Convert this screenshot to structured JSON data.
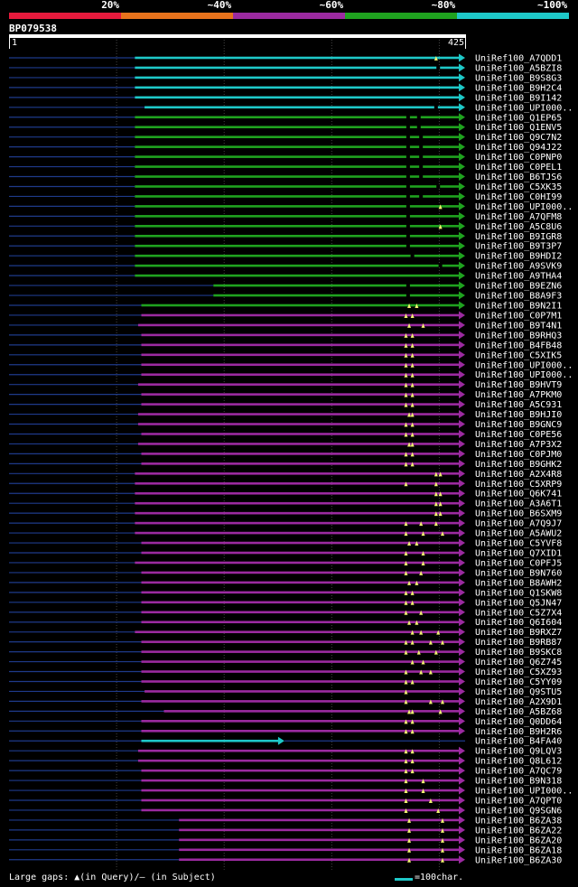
{
  "legend": {
    "bins": [
      {
        "label": "20%",
        "color": "#e51a3c"
      },
      {
        "label": "~40%",
        "color": "#e8731c"
      },
      {
        "label": "~60%",
        "color": "#9b2aa0"
      },
      {
        "label": "~80%",
        "color": "#1fa21f"
      },
      {
        "label": "~100%",
        "color": "#1ec8c8"
      }
    ]
  },
  "chart_data": {
    "type": "alignment",
    "query": {
      "name": "BP079538",
      "length": 425,
      "start_label": "1",
      "end_label": "425"
    },
    "colors": {
      "cyan": "#1ec8c8",
      "green": "#1fa21f",
      "purple": "#9b2aa0",
      "subject": "#1e3a8a",
      "marker": "#f0f070",
      "grid": "#444444"
    },
    "hits": [
      {
        "name": "UniRef100_A7QDD1",
        "q_start": 118,
        "q_end": 425,
        "color": "cyan",
        "ins": [
          398
        ],
        "subj_marks": []
      },
      {
        "name": "UniRef100_A5BZI8",
        "q_start": 118,
        "q_end": 425,
        "color": "cyan",
        "ins": [],
        "subj_marks": [
          400
        ]
      },
      {
        "name": "UniRef100_B9S8G3",
        "q_start": 118,
        "q_end": 425,
        "color": "cyan",
        "ins": [],
        "subj_marks": []
      },
      {
        "name": "UniRef100_B9H2C4",
        "q_start": 118,
        "q_end": 425,
        "color": "cyan",
        "ins": [],
        "subj_marks": []
      },
      {
        "name": "UniRef100_B9I142",
        "q_start": 118,
        "q_end": 425,
        "color": "cyan",
        "ins": [],
        "subj_marks": []
      },
      {
        "name": "UniRef100_UPI000..",
        "q_start": 127,
        "q_end": 425,
        "color": "cyan",
        "ins": [],
        "subj_marks": [
          398
        ]
      },
      {
        "name": "UniRef100_Q1EP65",
        "q_start": 118,
        "q_end": 425,
        "color": "green",
        "ins": [],
        "subj_marks": [
          372,
          382
        ]
      },
      {
        "name": "UniRef100_Q1ENV5",
        "q_start": 118,
        "q_end": 425,
        "color": "green",
        "ins": [],
        "subj_marks": [
          372,
          382
        ]
      },
      {
        "name": "UniRef100_Q9C7N2",
        "q_start": 118,
        "q_end": 425,
        "color": "green",
        "ins": [],
        "subj_marks": [
          372,
          384
        ]
      },
      {
        "name": "UniRef100_Q94J22",
        "q_start": 118,
        "q_end": 425,
        "color": "green",
        "ins": [],
        "subj_marks": [
          372,
          384
        ]
      },
      {
        "name": "UniRef100_C0PNP0",
        "q_start": 118,
        "q_end": 425,
        "color": "green",
        "ins": [],
        "subj_marks": [
          372,
          384
        ]
      },
      {
        "name": "UniRef100_C0PEL1",
        "q_start": 118,
        "q_end": 425,
        "color": "green",
        "ins": [],
        "subj_marks": [
          372,
          384
        ]
      },
      {
        "name": "UniRef100_B6TJS6",
        "q_start": 118,
        "q_end": 425,
        "color": "green",
        "ins": [],
        "subj_marks": [
          372,
          384
        ]
      },
      {
        "name": "UniRef100_C5XK35",
        "q_start": 118,
        "q_end": 425,
        "color": "green",
        "ins": [],
        "subj_marks": [
          372,
          400
        ]
      },
      {
        "name": "UniRef100_C0HI99",
        "q_start": 118,
        "q_end": 425,
        "color": "green",
        "ins": [],
        "subj_marks": [
          372,
          384
        ]
      },
      {
        "name": "UniRef100_UPI000..",
        "q_start": 118,
        "q_end": 425,
        "color": "green",
        "ins": [
          402
        ],
        "subj_marks": [
          372
        ]
      },
      {
        "name": "UniRef100_A7QFM8",
        "q_start": 118,
        "q_end": 425,
        "color": "green",
        "ins": [],
        "subj_marks": [
          372
        ]
      },
      {
        "name": "UniRef100_A5C8U6",
        "q_start": 118,
        "q_end": 425,
        "color": "green",
        "ins": [
          402
        ],
        "subj_marks": [
          372
        ]
      },
      {
        "name": "UniRef100_B9IGR8",
        "q_start": 118,
        "q_end": 425,
        "color": "green",
        "ins": [],
        "subj_marks": [
          372
        ]
      },
      {
        "name": "UniRef100_B9T3P7",
        "q_start": 118,
        "q_end": 425,
        "color": "green",
        "ins": [],
        "subj_marks": [
          372
        ]
      },
      {
        "name": "UniRef100_B9HDI2",
        "q_start": 118,
        "q_end": 425,
        "color": "green",
        "ins": [],
        "subj_marks": [
          376
        ]
      },
      {
        "name": "UniRef100_A9SVK9",
        "q_start": 118,
        "q_end": 425,
        "color": "green",
        "ins": [],
        "subj_marks": [
          402
        ]
      },
      {
        "name": "UniRef100_A9THA4",
        "q_start": 118,
        "q_end": 425,
        "color": "green",
        "ins": [],
        "subj_marks": []
      },
      {
        "name": "UniRef100_B9EZN6",
        "q_start": 191,
        "q_end": 425,
        "color": "green",
        "ins": [],
        "subj_marks": [
          372
        ]
      },
      {
        "name": "UniRef100_B8A9F3",
        "q_start": 191,
        "q_end": 425,
        "color": "green",
        "ins": [],
        "subj_marks": [
          372
        ]
      },
      {
        "name": "UniRef100_B9N2I1",
        "q_start": 124,
        "q_end": 425,
        "color": "green",
        "ins": [
          373,
          380
        ],
        "subj_marks": []
      },
      {
        "name": "UniRef100_C0P7M1",
        "q_start": 124,
        "q_end": 425,
        "color": "purple",
        "ins": [
          370,
          376
        ],
        "subj_marks": []
      },
      {
        "name": "UniRef100_B9T4N1",
        "q_start": 121,
        "q_end": 425,
        "color": "purple",
        "ins": [
          373,
          386
        ],
        "subj_marks": []
      },
      {
        "name": "UniRef100_B9RHQ3",
        "q_start": 124,
        "q_end": 425,
        "color": "purple",
        "ins": [
          370,
          376
        ],
        "subj_marks": []
      },
      {
        "name": "UniRef100_B4FB48",
        "q_start": 124,
        "q_end": 425,
        "color": "purple",
        "ins": [
          370,
          376
        ],
        "subj_marks": []
      },
      {
        "name": "UniRef100_C5XIK5",
        "q_start": 124,
        "q_end": 425,
        "color": "purple",
        "ins": [
          370,
          376
        ],
        "subj_marks": []
      },
      {
        "name": "UniRef100_UPI000..",
        "q_start": 124,
        "q_end": 425,
        "color": "purple",
        "ins": [
          370,
          376
        ],
        "subj_marks": []
      },
      {
        "name": "UniRef100_UPI000..",
        "q_start": 124,
        "q_end": 425,
        "color": "purple",
        "ins": [
          370,
          376
        ],
        "subj_marks": []
      },
      {
        "name": "UniRef100_B9HVT9",
        "q_start": 121,
        "q_end": 425,
        "color": "purple",
        "ins": [
          370,
          376
        ],
        "subj_marks": []
      },
      {
        "name": "UniRef100_A7PKM0",
        "q_start": 124,
        "q_end": 425,
        "color": "purple",
        "ins": [
          370,
          376
        ],
        "subj_marks": []
      },
      {
        "name": "UniRef100_A5C931",
        "q_start": 124,
        "q_end": 425,
        "color": "purple",
        "ins": [
          370,
          376
        ],
        "subj_marks": []
      },
      {
        "name": "UniRef100_B9HJI0",
        "q_start": 121,
        "q_end": 425,
        "color": "purple",
        "ins": [
          373,
          376
        ],
        "subj_marks": []
      },
      {
        "name": "UniRef100_B9GNC9",
        "q_start": 121,
        "q_end": 425,
        "color": "purple",
        "ins": [
          370,
          376
        ],
        "subj_marks": []
      },
      {
        "name": "UniRef100_C0PE56",
        "q_start": 124,
        "q_end": 425,
        "color": "purple",
        "ins": [
          370,
          376
        ],
        "subj_marks": []
      },
      {
        "name": "UniRef100_A7P3X2",
        "q_start": 121,
        "q_end": 425,
        "color": "purple",
        "ins": [
          373,
          376
        ],
        "subj_marks": []
      },
      {
        "name": "UniRef100_C0PJM0",
        "q_start": 124,
        "q_end": 425,
        "color": "purple",
        "ins": [
          370,
          376
        ],
        "subj_marks": []
      },
      {
        "name": "UniRef100_B9GHK2",
        "q_start": 124,
        "q_end": 425,
        "color": "purple",
        "ins": [
          370,
          376
        ],
        "subj_marks": []
      },
      {
        "name": "UniRef100_A2X4R8",
        "q_start": 118,
        "q_end": 425,
        "color": "purple",
        "ins": [
          398,
          402
        ],
        "subj_marks": []
      },
      {
        "name": "UniRef100_C5XRP9",
        "q_start": 118,
        "q_end": 425,
        "color": "purple",
        "ins": [
          370,
          398
        ],
        "subj_marks": []
      },
      {
        "name": "UniRef100_Q6K741",
        "q_start": 118,
        "q_end": 425,
        "color": "purple",
        "ins": [
          398,
          402
        ],
        "subj_marks": []
      },
      {
        "name": "UniRef100_A3A6T1",
        "q_start": 118,
        "q_end": 425,
        "color": "purple",
        "ins": [
          398,
          402
        ],
        "subj_marks": []
      },
      {
        "name": "UniRef100_B6SXM9",
        "q_start": 118,
        "q_end": 425,
        "color": "purple",
        "ins": [
          398,
          402
        ],
        "subj_marks": []
      },
      {
        "name": "UniRef100_A7Q9J7",
        "q_start": 118,
        "q_end": 425,
        "color": "purple",
        "ins": [
          370,
          384,
          398
        ],
        "subj_marks": []
      },
      {
        "name": "UniRef100_A5AWU2",
        "q_start": 118,
        "q_end": 425,
        "color": "purple",
        "ins": [
          370,
          386,
          404
        ],
        "subj_marks": []
      },
      {
        "name": "UniRef100_C5YVF8",
        "q_start": 124,
        "q_end": 425,
        "color": "purple",
        "ins": [
          373,
          380
        ],
        "subj_marks": []
      },
      {
        "name": "UniRef100_Q7XID1",
        "q_start": 124,
        "q_end": 425,
        "color": "purple",
        "ins": [
          370,
          386
        ],
        "subj_marks": []
      },
      {
        "name": "UniRef100_C0PFJ5",
        "q_start": 118,
        "q_end": 425,
        "color": "purple",
        "ins": [
          370,
          386
        ],
        "subj_marks": []
      },
      {
        "name": "UniRef100_B9N760",
        "q_start": 124,
        "q_end": 425,
        "color": "purple",
        "ins": [
          370,
          384
        ],
        "subj_marks": []
      },
      {
        "name": "UniRef100_B8AWH2",
        "q_start": 124,
        "q_end": 425,
        "color": "purple",
        "ins": [
          373,
          380
        ],
        "subj_marks": []
      },
      {
        "name": "UniRef100_Q1SKW8",
        "q_start": 124,
        "q_end": 425,
        "color": "purple",
        "ins": [
          370,
          376
        ],
        "subj_marks": []
      },
      {
        "name": "UniRef100_Q5JN47",
        "q_start": 124,
        "q_end": 425,
        "color": "purple",
        "ins": [
          370,
          376
        ],
        "subj_marks": []
      },
      {
        "name": "UniRef100_C5Z7X4",
        "q_start": 124,
        "q_end": 425,
        "color": "purple",
        "ins": [
          370,
          384
        ],
        "subj_marks": []
      },
      {
        "name": "UniRef100_Q6I604",
        "q_start": 124,
        "q_end": 425,
        "color": "purple",
        "ins": [
          373,
          380
        ],
        "subj_marks": []
      },
      {
        "name": "UniRef100_B9RXZ7",
        "q_start": 118,
        "q_end": 425,
        "color": "purple",
        "ins": [
          376,
          384,
          400
        ],
        "subj_marks": []
      },
      {
        "name": "UniRef100_B9RB87",
        "q_start": 124,
        "q_end": 425,
        "color": "purple",
        "ins": [
          370,
          376,
          393,
          404
        ],
        "subj_marks": []
      },
      {
        "name": "UniRef100_B9SKC8",
        "q_start": 124,
        "q_end": 425,
        "color": "purple",
        "ins": [
          370,
          382,
          398
        ],
        "subj_marks": []
      },
      {
        "name": "UniRef100_Q6Z745",
        "q_start": 124,
        "q_end": 425,
        "color": "purple",
        "ins": [
          376,
          386
        ],
        "subj_marks": []
      },
      {
        "name": "UniRef100_C5XZ93",
        "q_start": 124,
        "q_end": 425,
        "color": "purple",
        "ins": [
          370,
          384,
          393
        ],
        "subj_marks": []
      },
      {
        "name": "UniRef100_C5YY09",
        "q_start": 124,
        "q_end": 425,
        "color": "purple",
        "ins": [
          370,
          376
        ],
        "subj_marks": []
      },
      {
        "name": "UniRef100_Q9STU5",
        "q_start": 127,
        "q_end": 425,
        "color": "purple",
        "ins": [
          370
        ],
        "subj_marks": []
      },
      {
        "name": "UniRef100_A2X9D1",
        "q_start": 124,
        "q_end": 425,
        "color": "purple",
        "ins": [
          370,
          393,
          404
        ],
        "subj_marks": []
      },
      {
        "name": "UniRef100_A5BZ68",
        "q_start": 145,
        "q_end": 425,
        "color": "purple",
        "ins": [
          373,
          376,
          402
        ],
        "subj_marks": []
      },
      {
        "name": "UniRef100_Q0DD64",
        "q_start": 124,
        "q_end": 425,
        "color": "purple",
        "ins": [
          370,
          376
        ],
        "subj_marks": []
      },
      {
        "name": "UniRef100_B9H2R6",
        "q_start": 124,
        "q_end": 425,
        "color": "purple",
        "ins": [
          370,
          376
        ],
        "subj_marks": []
      },
      {
        "name": "UniRef100_B4FA40",
        "q_start": 124,
        "q_end": 257,
        "color": "cyan",
        "ins": [],
        "subj_marks": []
      },
      {
        "name": "UniRef100_Q9LQV3",
        "q_start": 121,
        "q_end": 425,
        "color": "purple",
        "ins": [
          370,
          376
        ],
        "subj_marks": []
      },
      {
        "name": "UniRef100_Q8L612",
        "q_start": 121,
        "q_end": 425,
        "color": "purple",
        "ins": [
          370,
          376
        ],
        "subj_marks": []
      },
      {
        "name": "UniRef100_A7QC79",
        "q_start": 124,
        "q_end": 425,
        "color": "purple",
        "ins": [
          370,
          376
        ],
        "subj_marks": []
      },
      {
        "name": "UniRef100_B9N318",
        "q_start": 124,
        "q_end": 425,
        "color": "purple",
        "ins": [
          370,
          386
        ],
        "subj_marks": []
      },
      {
        "name": "UniRef100_UPI000..",
        "q_start": 124,
        "q_end": 425,
        "color": "purple",
        "ins": [
          370,
          386
        ],
        "subj_marks": []
      },
      {
        "name": "UniRef100_A7QPT0",
        "q_start": 124,
        "q_end": 425,
        "color": "purple",
        "ins": [
          370,
          393
        ],
        "subj_marks": []
      },
      {
        "name": "UniRef100_Q9SGN6",
        "q_start": 124,
        "q_end": 425,
        "color": "purple",
        "ins": [
          370,
          400
        ],
        "subj_marks": []
      },
      {
        "name": "UniRef100_B6ZA38",
        "q_start": 159,
        "q_end": 425,
        "color": "purple",
        "ins": [
          373,
          404
        ],
        "subj_marks": []
      },
      {
        "name": "UniRef100_B6ZA22",
        "q_start": 159,
        "q_end": 425,
        "color": "purple",
        "ins": [
          373,
          404
        ],
        "subj_marks": []
      },
      {
        "name": "UniRef100_B6ZA20",
        "q_start": 159,
        "q_end": 425,
        "color": "purple",
        "ins": [
          373,
          404
        ],
        "subj_marks": []
      },
      {
        "name": "UniRef100_B6ZA18",
        "q_start": 159,
        "q_end": 425,
        "color": "purple",
        "ins": [
          373,
          404
        ],
        "subj_marks": []
      },
      {
        "name": "UniRef100_B6ZA30",
        "q_start": 159,
        "q_end": 425,
        "color": "purple",
        "ins": [
          373,
          404
        ],
        "subj_marks": []
      }
    ]
  },
  "footer": {
    "gaps_label": "Large gaps: ▲(in Query)/— (in Subject)",
    "scale_label": "=100char."
  }
}
